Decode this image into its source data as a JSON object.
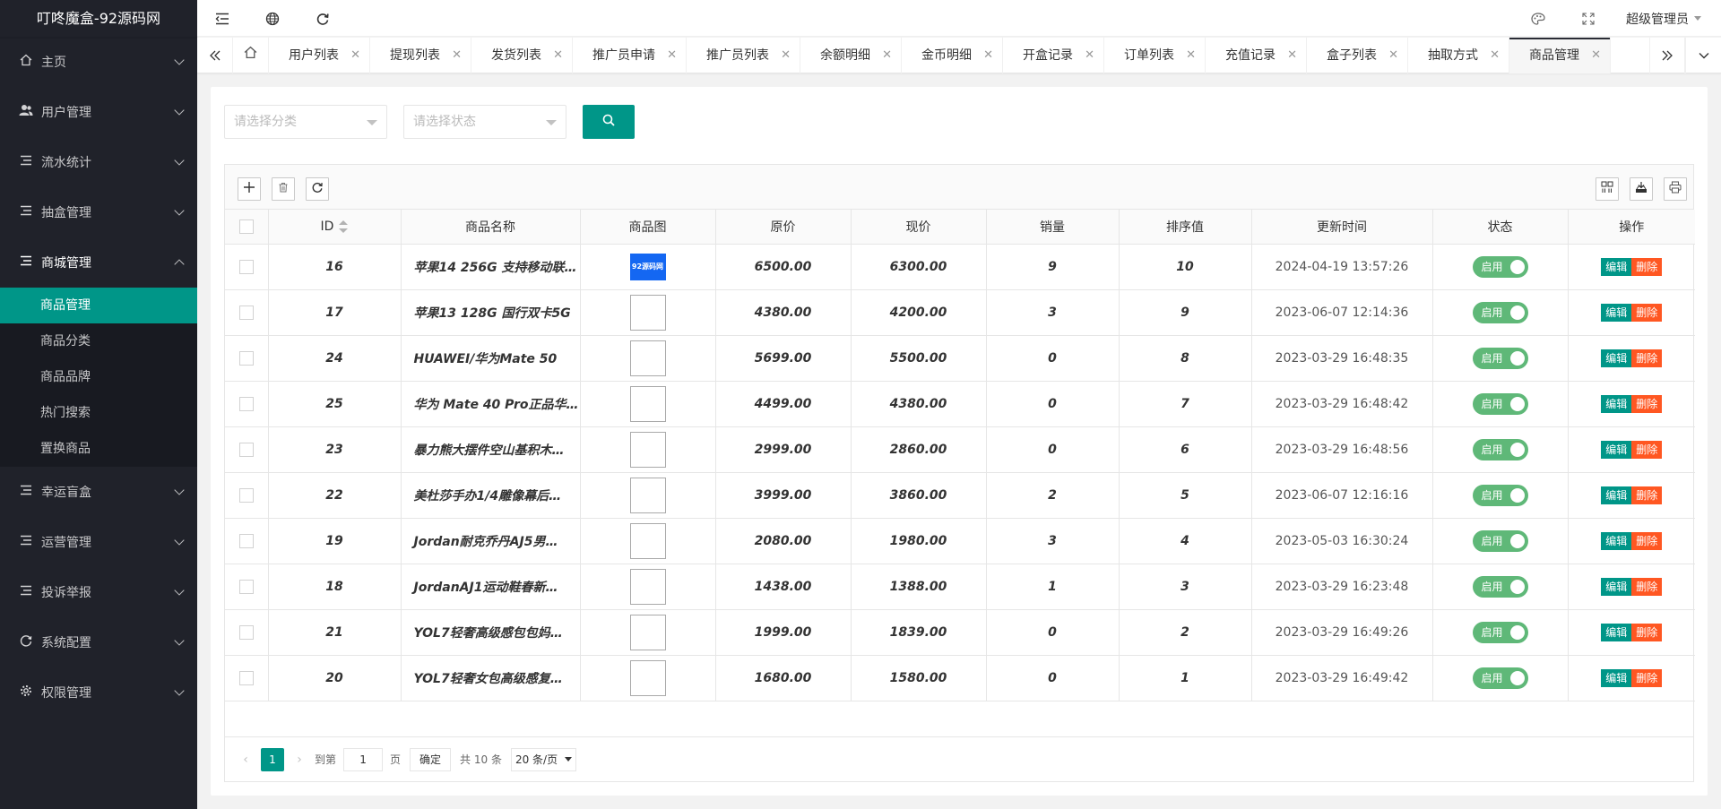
{
  "app": {
    "logo": "叮咚魔盒-92源码网"
  },
  "colors": {
    "sidebar": "#20222a",
    "accent": "#009688",
    "danger": "#ff5722",
    "switch_on": "#5fb878"
  },
  "sidebar": {
    "items": [
      {
        "label": "主页",
        "icon": "home-icon"
      },
      {
        "label": "用户管理",
        "icon": "users-icon"
      },
      {
        "label": "流水统计",
        "icon": "list-icon"
      },
      {
        "label": "抽盒管理",
        "icon": "list-icon"
      },
      {
        "label": "商城管理",
        "icon": "list-icon"
      },
      {
        "label": "幸运盲盒",
        "icon": "list-icon"
      },
      {
        "label": "运营管理",
        "icon": "list-icon"
      },
      {
        "label": "投诉举报",
        "icon": "list-icon"
      },
      {
        "label": "系统配置",
        "icon": "cycle-icon"
      },
      {
        "label": "权限管理",
        "icon": "gear-icon"
      }
    ],
    "sub_items": [
      "商品管理",
      "商品分类",
      "商品品牌",
      "热门搜索",
      "置换商品"
    ]
  },
  "header": {
    "user": "超级管理员"
  },
  "tabs": [
    "用户列表",
    "提现列表",
    "发货列表",
    "推广员申请",
    "推广员列表",
    "余额明细",
    "金币明细",
    "开盒记录",
    "订单列表",
    "充值记录",
    "盒子列表",
    "抽取方式",
    "商品管理"
  ],
  "filters": {
    "category_placeholder": "请选择分类",
    "status_placeholder": "请选择状态"
  },
  "table": {
    "headers": [
      "ID",
      "商品名称",
      "商品图",
      "原价",
      "现价",
      "销量",
      "排序值",
      "更新时间",
      "状态",
      "操作"
    ],
    "status_label": "启用",
    "edit_label": "编辑",
    "delete_label": "删除",
    "thumb_logo": "92源码网",
    "rows": [
      {
        "id": "16",
        "name": "苹果14 256G 支持移动联…",
        "orig": "6500.00",
        "price": "6300.00",
        "sales": "9",
        "sort": "10",
        "time": "2024-04-19 13:57:26"
      },
      {
        "id": "17",
        "name": "苹果13 128G 国行双卡5G",
        "orig": "4380.00",
        "price": "4200.00",
        "sales": "3",
        "sort": "9",
        "time": "2023-06-07 12:14:36"
      },
      {
        "id": "24",
        "name": "HUAWEI/华为Mate 50",
        "orig": "5699.00",
        "price": "5500.00",
        "sales": "0",
        "sort": "8",
        "time": "2023-03-29 16:48:35"
      },
      {
        "id": "25",
        "name": "华为 Mate 40 Pro正品华…",
        "orig": "4499.00",
        "price": "4380.00",
        "sales": "0",
        "sort": "7",
        "time": "2023-03-29 16:48:42"
      },
      {
        "id": "23",
        "name": "暴力熊大摆件空山基积木…",
        "orig": "2999.00",
        "price": "2860.00",
        "sales": "0",
        "sort": "6",
        "time": "2023-03-29 16:48:56"
      },
      {
        "id": "22",
        "name": "美杜莎手办1/4雕像幕后…",
        "orig": "3999.00",
        "price": "3860.00",
        "sales": "2",
        "sort": "5",
        "time": "2023-06-07 12:16:16"
      },
      {
        "id": "19",
        "name": "Jordan耐克乔丹AJ5男…",
        "orig": "2080.00",
        "price": "1980.00",
        "sales": "3",
        "sort": "4",
        "time": "2023-05-03 16:30:24"
      },
      {
        "id": "18",
        "name": "JordanAJ1运动鞋春新…",
        "orig": "1438.00",
        "price": "1388.00",
        "sales": "1",
        "sort": "3",
        "time": "2023-03-29 16:23:48"
      },
      {
        "id": "21",
        "name": "YOL7轻奢高级感包包妈…",
        "orig": "1999.00",
        "price": "1839.00",
        "sales": "0",
        "sort": "2",
        "time": "2023-03-29 16:49:26"
      },
      {
        "id": "20",
        "name": "YOL7轻奢女包高级感复…",
        "orig": "1680.00",
        "price": "1580.00",
        "sales": "0",
        "sort": "1",
        "time": "2023-03-29 16:49:42"
      }
    ]
  },
  "pager": {
    "current": "1",
    "goto_label": "到第",
    "page_input": "1",
    "page_label": "页",
    "confirm_label": "确定",
    "total": "共 10 条",
    "page_size": "20 条/页"
  }
}
